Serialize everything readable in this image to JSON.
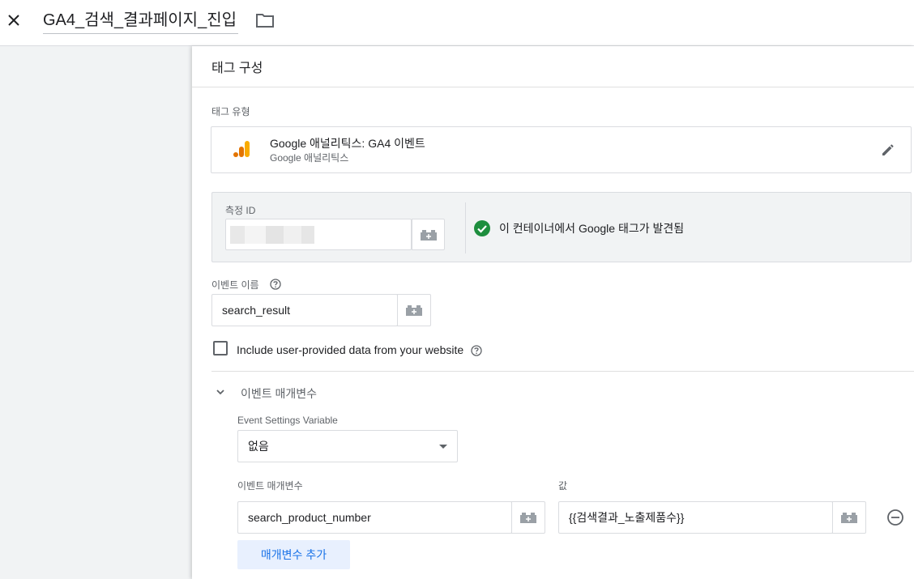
{
  "header": {
    "close_icon": "close-icon",
    "tag_name": "GA4_검색_결과페이지_진입",
    "folder_icon": "folder-icon"
  },
  "panel": {
    "title": "태그 구성",
    "tag_type": {
      "label": "태그 유형",
      "name": "Google 애널리틱스: GA4 이벤트",
      "subtitle": "Google 애널리틱스",
      "edit_icon": "pencil-icon"
    },
    "measurement": {
      "label": "측정 ID",
      "value": "",
      "status": "이 컨테이너에서 Google 태그가 발견됨",
      "status_color": "#1e8e3e"
    },
    "event_name": {
      "label": "이벤트 이름",
      "value": "search_result"
    },
    "user_data": {
      "label": "Include user-provided data from your website",
      "checked": false
    },
    "event_params": {
      "section_title": "이벤트 매개변수",
      "settings_var_label": "Event Settings Variable",
      "settings_var_value": "없음",
      "param_col_label": "이벤트 매개변수",
      "value_col_label": "값",
      "rows": [
        {
          "name": "search_product_number",
          "value": "{{검색결과_노출제품수}}"
        }
      ],
      "add_button": "매개변수 추가"
    }
  },
  "colors": {
    "accent": "#1a73e8",
    "accent_bg": "#e8f0fe",
    "ga_orange": "#f9ab00",
    "ga_dark_orange": "#e37400"
  }
}
